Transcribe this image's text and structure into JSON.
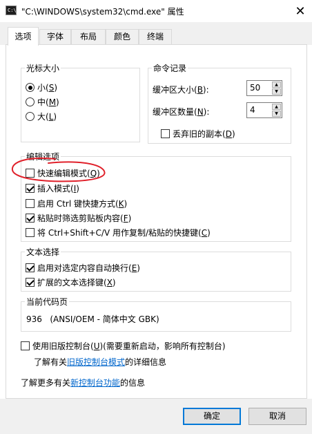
{
  "window": {
    "title": "\"C:\\WINDOWS\\system32\\cmd.exe\" 属性",
    "icon_text": "C:\\_",
    "close_glyph": "✕"
  },
  "tabs": [
    "选项",
    "字体",
    "布局",
    "颜色",
    "终端"
  ],
  "cursor_size": {
    "title": "光标大小",
    "options": [
      {
        "label": "小(",
        "key": "S",
        "end": ")",
        "selected": true
      },
      {
        "label": "中(",
        "key": "M",
        "end": ")",
        "selected": false
      },
      {
        "label": "大(",
        "key": "L",
        "end": ")",
        "selected": false
      }
    ]
  },
  "history": {
    "title": "命令记录",
    "buffer_size_label": "缓冲区大小(",
    "buffer_size_key": "B",
    "buffer_size_end": "):",
    "buffer_size_value": "50",
    "buffer_count_label": "缓冲区数量(",
    "buffer_count_key": "N",
    "buffer_count_end": "):",
    "buffer_count_value": "4",
    "discard_label": "丢弃旧的副本(",
    "discard_key": "D",
    "discard_end": ")",
    "discard_checked": false
  },
  "edit_options": {
    "title": "编辑选项",
    "items": [
      {
        "label": "快速编辑模式(",
        "key": "Q",
        "end": ")",
        "checked": false
      },
      {
        "label": "插入模式(",
        "key": "I",
        "end": ")",
        "checked": true
      },
      {
        "label": "启用 Ctrl 键快捷方式(",
        "key": "K",
        "end": ")",
        "checked": false
      },
      {
        "label": "粘贴时筛选剪贴板内容(",
        "key": "F",
        "end": ")",
        "checked": true
      },
      {
        "label": "将 Ctrl+Shift+C/V 用作复制/粘贴的快捷键(",
        "key": "C",
        "end": ")",
        "checked": false
      }
    ],
    "annotation_color": "#e0202a"
  },
  "text_selection": {
    "title": "文本选择",
    "items": [
      {
        "label": "启用对选定内容自动换行(",
        "key": "E",
        "end": ")",
        "checked": true
      },
      {
        "label": "扩展的文本选择键(",
        "key": "X",
        "end": ")",
        "checked": true
      }
    ]
  },
  "codepage": {
    "title": "当前代码页",
    "value": "936   (ANSI/OEM - 简体中文 GBK)"
  },
  "legacy": {
    "checkbox_label": "使用旧版控制台(",
    "checkbox_key": "U",
    "checkbox_end": ")(需要重新启动，影响所有控制台)",
    "checked": false,
    "info_prefix": "了解有关",
    "info_link": "旧版控制台模式",
    "info_suffix": "的详细信息"
  },
  "more_info": {
    "prefix": "了解更多有关",
    "link": "新控制台功能",
    "suffix": "的信息"
  },
  "buttons": {
    "ok": "确定",
    "cancel": "取消"
  }
}
